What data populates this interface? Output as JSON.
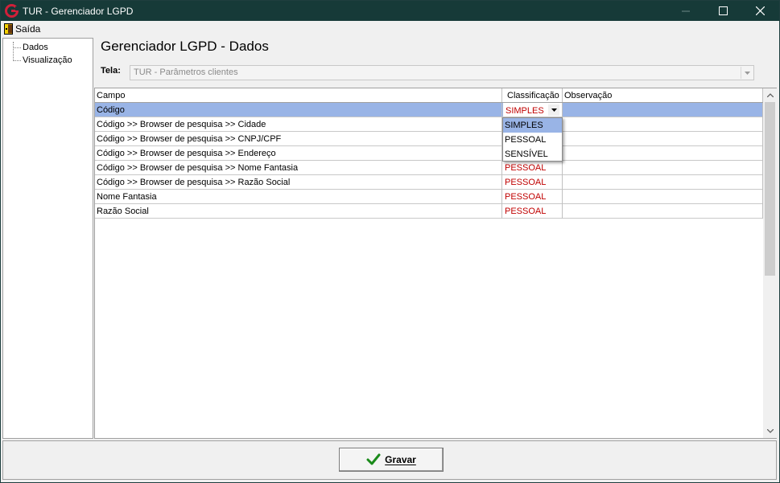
{
  "window": {
    "title": "TUR - Gerenciador LGPD"
  },
  "menu": {
    "exit_label": "Saída"
  },
  "tree": {
    "items": [
      {
        "label": "Dados"
      },
      {
        "label": "Visualização"
      }
    ]
  },
  "main": {
    "title": "Gerenciador LGPD - Dados",
    "tela_label": "Tela:",
    "tela_value": "TUR - Parâmetros clientes"
  },
  "grid": {
    "columns": [
      "Campo",
      "Classificação",
      "Observação"
    ],
    "rows": [
      {
        "campo": "Código",
        "classificacao": "SIMPLES",
        "observacao": ""
      },
      {
        "campo": "Código >> Browser de pesquisa >> Cidade",
        "classificacao": "",
        "observacao": ""
      },
      {
        "campo": "Código >> Browser de pesquisa >> CNPJ/CPF",
        "classificacao": "",
        "observacao": ""
      },
      {
        "campo": "Código >> Browser de pesquisa >> Endereço",
        "classificacao": "",
        "observacao": ""
      },
      {
        "campo": "Código >> Browser de pesquisa >> Nome Fantasia",
        "classificacao": "PESSOAL",
        "observacao": ""
      },
      {
        "campo": "Código >> Browser de pesquisa >> Razão Social",
        "classificacao": "PESSOAL",
        "observacao": ""
      },
      {
        "campo": "Nome Fantasia",
        "classificacao": "PESSOAL",
        "observacao": ""
      },
      {
        "campo": "Razão Social",
        "classificacao": "PESSOAL",
        "observacao": ""
      }
    ],
    "dropdown_options": [
      "SIMPLES",
      "PESSOAL",
      "SENSÍVEL"
    ],
    "dropdown_selected": "SIMPLES"
  },
  "footer": {
    "save_label": "Gravar"
  },
  "colors": {
    "titlebar": "#163a38",
    "selection": "#99b4e6",
    "classification_text": "#c00000"
  }
}
